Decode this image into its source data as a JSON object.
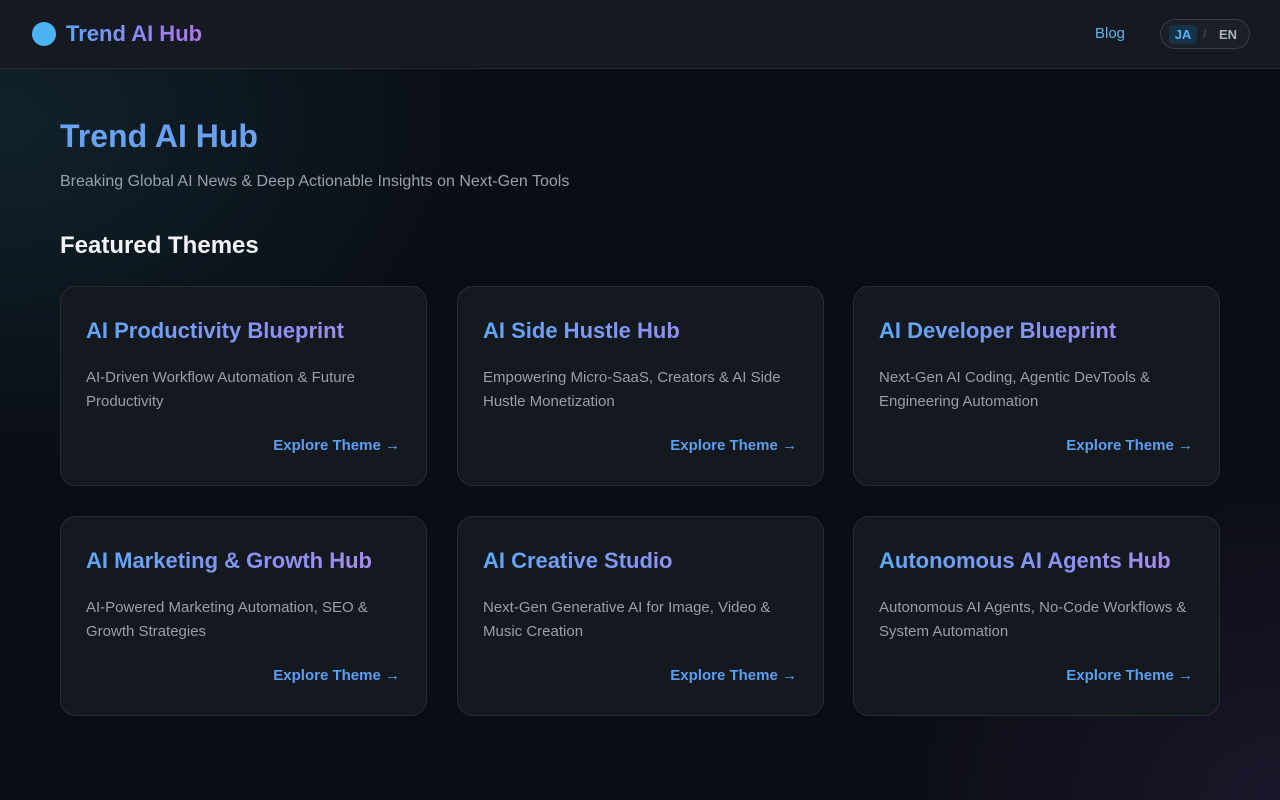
{
  "header": {
    "brand": "Trend AI Hub",
    "nav_blog": "Blog",
    "lang": {
      "ja": "JA",
      "separator": "/",
      "en": "EN",
      "active": "JA"
    }
  },
  "hero": {
    "title": "Trend AI Hub",
    "subtitle": "Breaking Global AI News & Deep Actionable Insights on Next-Gen Tools"
  },
  "featured": {
    "title": "Featured Themes",
    "cards": [
      {
        "title": "AI Productivity Blueprint",
        "description": "AI-Driven Workflow Automation & Future Productivity",
        "link": "Explore Theme →"
      },
      {
        "title": "AI Side Hustle Hub",
        "description": "Empowering Micro-SaaS, Creators & AI Side Hustle Monetization",
        "link": "Explore Theme →"
      },
      {
        "title": "AI Developer Blueprint",
        "description": "Next-Gen AI Coding, Agentic DevTools & Engineering Automation",
        "link": "Explore Theme →"
      },
      {
        "title": "AI Marketing & Growth Hub",
        "description": "AI-Powered Marketing Automation, SEO & Growth Strategies",
        "link": "Explore Theme →"
      },
      {
        "title": "AI Creative Studio",
        "description": "Next-Gen Generative AI for Image, Video & Music Creation",
        "link": "Explore Theme →"
      },
      {
        "title": "Autonomous AI Agents Hub",
        "description": "Autonomous AI Agents, No-Code Workflows & System Automation",
        "link": "Explore Theme →"
      }
    ]
  },
  "colors": {
    "background": "#0a0d14",
    "header_bg": "#151a22",
    "accent_blue": "#5fa8f7",
    "accent_purple": "#b176ea",
    "link": "#5c9ef0"
  }
}
